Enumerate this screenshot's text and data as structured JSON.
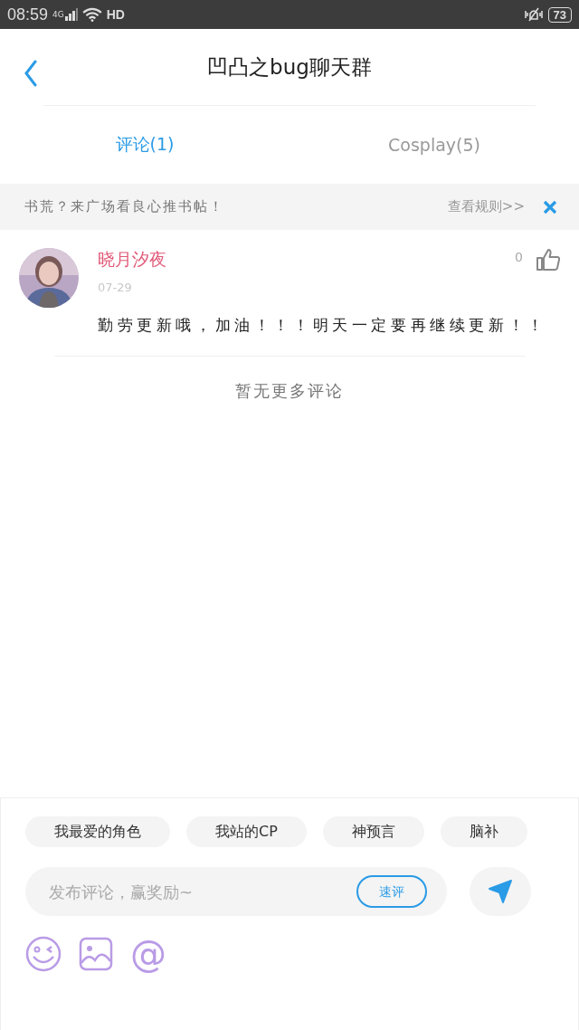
{
  "status_bar": {
    "time": "08:59",
    "network": "4G",
    "hd": "HD",
    "battery": "73"
  },
  "header": {
    "title": "凹凸之bug聊天群"
  },
  "tabs": [
    {
      "label": "评论(1)",
      "selected": true
    },
    {
      "label": "Cosplay(5)",
      "selected": false
    }
  ],
  "banner": {
    "text": "书荒？来广场看良心推书帖！",
    "link": "查看规则>>"
  },
  "comments": [
    {
      "author": "晓月汐夜",
      "date": "07-29",
      "likes": "0",
      "liked": false,
      "text": "勤劳更新哦，加油！！！明天一定要再继续更新！！"
    }
  ],
  "end_note": "暂无更多评论",
  "composer": {
    "chips": [
      {
        "label": "我最爱的角色"
      },
      {
        "label": "我站的CP"
      },
      {
        "label": "神预言"
      },
      {
        "label": "脑补"
      }
    ],
    "placeholder": "发布评论，赢奖励~",
    "quick_button": "速评",
    "mention": "@"
  }
}
